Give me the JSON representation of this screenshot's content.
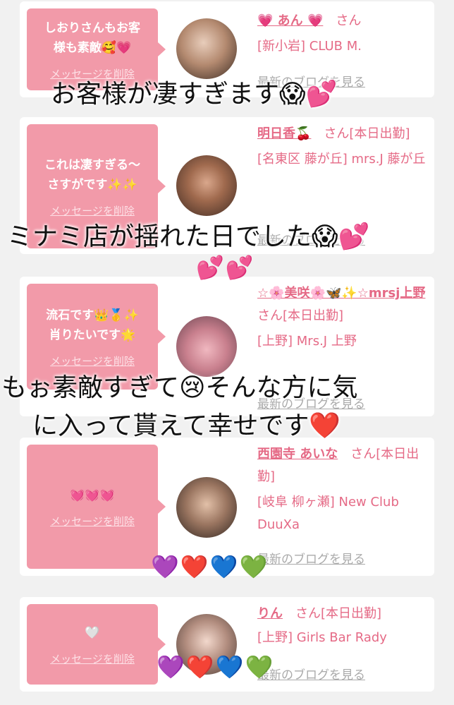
{
  "cards": [
    {
      "bubble": "しおりさんもお客\n様も素敵🥰💗",
      "delete_label": "メッセージを削除",
      "name": "💗 あん 💗",
      "san": "さん",
      "shop": "[新小岩] CLUB M.",
      "blog": "最新のブログを見る"
    },
    {
      "bubble": "これは凄すぎる〜\nさすがです✨✨",
      "delete_label": "メッセージを削除",
      "name": "明日香🍒",
      "san": "さん[本日出勤]",
      "shop": "[名東区 藤が丘] mrs.J 藤が丘",
      "blog": "最新のブログを見る"
    },
    {
      "bubble": "流石です👑🥇✨\n肖りたいです🌟",
      "delete_label": "メッセージを削除",
      "name": "☆🌸美咲🌸🦋✨☆mrsj上野",
      "san": "さん[本日出勤]",
      "shop": "[上野] Mrs.J 上野",
      "blog": "最新のブログを見る"
    },
    {
      "bubble": "💓💓💓",
      "delete_label": "メッセージを削除",
      "name": "西園寺 あいな",
      "san": "さん[本日出勤]",
      "shop": "[岐阜 柳ヶ瀬] New Club DuuXa",
      "blog": "最新のブログを見る"
    },
    {
      "bubble": "🤍",
      "delete_label": "メッセージを削除",
      "name": "りん",
      "san": "さん[本日出勤]",
      "shop": "[上野] Girls Bar Rady",
      "blog": "最新のブログを見る"
    }
  ],
  "overlays": {
    "line1": "お客様が凄すぎます😱💕",
    "line2": "ミナミ店が揺れた日でした😱💕",
    "line2_hearts": "💕💕",
    "line3": "もぉ素敵すぎて😢そんな方に気",
    "line4": "に入って貰えて幸せです❤️",
    "hearts_row1": "💜❤️💙💚",
    "hearts_row2": "💜❤️💙💚"
  },
  "colors": {
    "bubble": "#f29aa9",
    "name_pink": "#e56a86",
    "background": "#f1f1f1"
  }
}
